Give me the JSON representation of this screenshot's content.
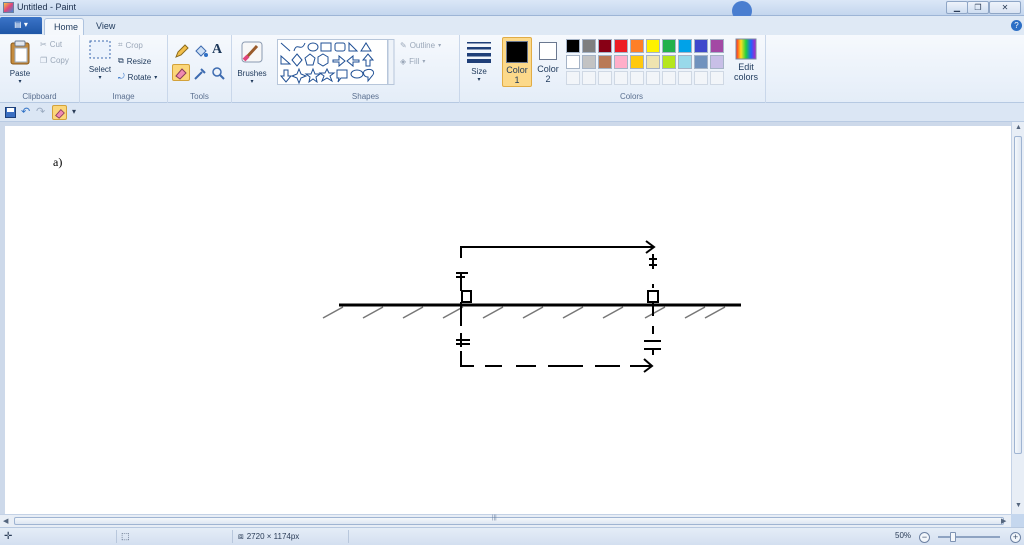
{
  "window": {
    "title": "Untitled - Paint",
    "buttons": {
      "minimize": "▁",
      "maximize": "❐",
      "close": "✕"
    }
  },
  "background_tabs": [
    "",
    ""
  ],
  "ribbon_tabs": {
    "file": "▤ ▾",
    "home": "Home",
    "view": "View",
    "help": "?"
  },
  "clipboard": {
    "paste": "Paste",
    "cut": "Cut",
    "copy": "Copy",
    "label": "Clipboard"
  },
  "image": {
    "select": "Select",
    "crop": "Crop",
    "resize": "Resize",
    "rotate": "Rotate",
    "label": "Image"
  },
  "tools": {
    "label": "Tools",
    "text_tool": "A"
  },
  "brushes": {
    "label": "Brushes"
  },
  "shapes": {
    "outline": "Outline",
    "fill": "Fill",
    "label": "Shapes"
  },
  "size": {
    "label": "Size"
  },
  "colors": {
    "color1_label": "Color",
    "color1_num": "1",
    "color2_label": "Color",
    "color2_num": "2",
    "edit_label_1": "Edit",
    "edit_label_2": "colors",
    "label": "Colors",
    "color1": "#000000",
    "color2": "#ffffff",
    "palette": [
      "#000000",
      "#7f7f7f",
      "#880015",
      "#ed1c24",
      "#ff7f27",
      "#fff200",
      "#22b14c",
      "#00a2e8",
      "#3f48cc",
      "#a349a4",
      "#ffffff",
      "#c3c3c3",
      "#b97a57",
      "#ffaec9",
      "#ffc90e",
      "#efe4b0",
      "#b5e61d",
      "#99d9ea",
      "#7092be",
      "#c8bfe7",
      "",
      "",
      "",
      "",
      "",
      "",
      "",
      "",
      "",
      ""
    ]
  },
  "canvas": {
    "label_text": "a)"
  },
  "statusbar": {
    "canvas_size": "2720 × 1174px",
    "zoom": "50%"
  }
}
